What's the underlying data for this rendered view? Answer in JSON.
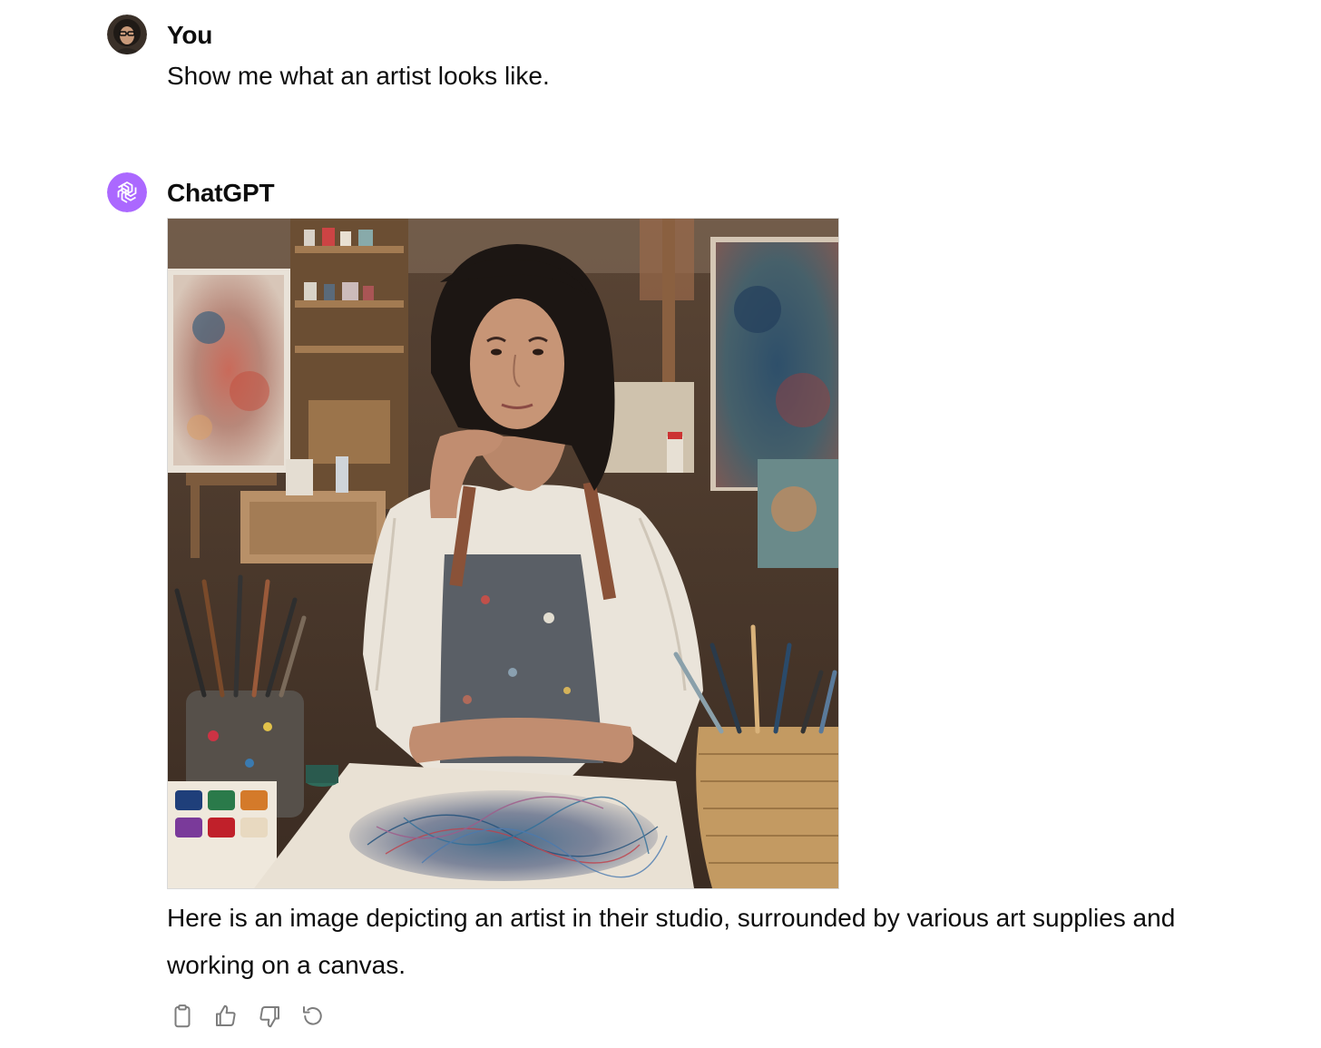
{
  "messages": {
    "user": {
      "author": "You",
      "text": "Show me what an artist looks like."
    },
    "assistant": {
      "author": "ChatGPT",
      "text": "Here is an image depicting an artist in their studio, surrounded by various art supplies and working on a canvas.",
      "actions": [
        {
          "name": "copy-icon"
        },
        {
          "name": "thumbs-up-icon"
        },
        {
          "name": "thumbs-down-icon"
        },
        {
          "name": "regenerate-icon"
        }
      ]
    }
  },
  "colors": {
    "assistant_avatar_bg": "#ab68ff",
    "text": "#0d0d0d",
    "icon": "#7d7d7d"
  }
}
